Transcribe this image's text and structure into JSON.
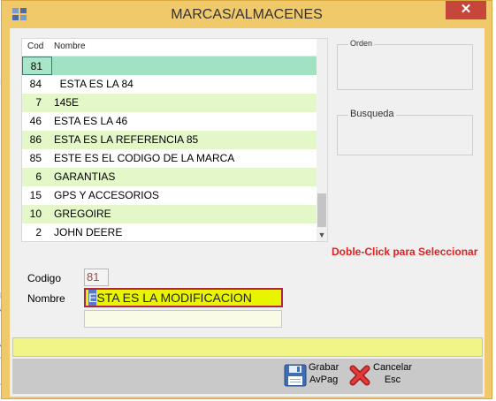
{
  "window": {
    "title": "MARCAS/ALMACENES",
    "close_glyph": "✕"
  },
  "grid": {
    "columns": [
      "Cod",
      "Nombre"
    ],
    "rows": [
      {
        "cod": "81",
        "nombre": ""
      },
      {
        "cod": "84",
        "nombre": "  ESTA ES LA 84"
      },
      {
        "cod": "7",
        "nombre": "145E"
      },
      {
        "cod": "46",
        "nombre": "ESTA ES LA 46"
      },
      {
        "cod": "86",
        "nombre": "ESTA ES LA REFERENCIA 85"
      },
      {
        "cod": "85",
        "nombre": "ESTE ES EL CODIGO DE LA MARCA"
      },
      {
        "cod": "6",
        "nombre": "GARANTIAS"
      },
      {
        "cod": "15",
        "nombre": "GPS Y ACCESORIOS"
      },
      {
        "cod": "10",
        "nombre": "GREGOIRE"
      },
      {
        "cod": "2",
        "nombre": "JOHN DEERE"
      }
    ]
  },
  "groups": {
    "orden": "Orden",
    "busqueda": "Busqueda"
  },
  "hint": "Doble-Click para Seleccionar",
  "form": {
    "codigo_label": "Codigo",
    "codigo_value": "81",
    "nombre_label": "Nombre",
    "nombre_first": "E",
    "nombre_rest": "STA ES LA MODIFICACION"
  },
  "buttons": {
    "grabar_line1": "Grabar",
    "grabar_line2": "AvPag",
    "cancelar_line1": "Cancelar",
    "cancelar_line2": "Esc"
  },
  "colors": {
    "frame": "#f0c96a",
    "close": "#c7463b",
    "row_alt": "#e3f7c8",
    "row_selected": "#a0e2c2",
    "input_highlight": "#e9f500",
    "hint": "#e02020",
    "status_bar": "#f1f587"
  },
  "icons": {
    "app": "app-icon",
    "save": "floppy-disk-icon",
    "cancel": "red-x-icon"
  }
}
